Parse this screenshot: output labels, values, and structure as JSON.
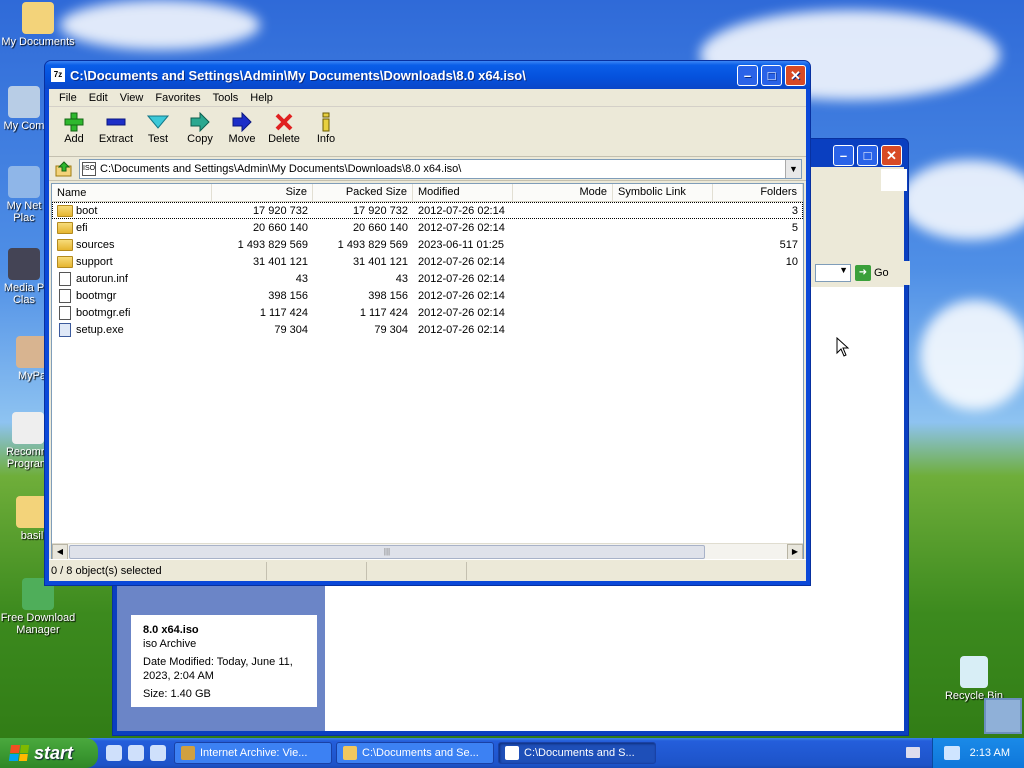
{
  "desktop": {
    "icons": [
      {
        "label": "My Documents"
      },
      {
        "label": "My Com"
      },
      {
        "label": "My Net Plac"
      },
      {
        "label": "Media P Clas"
      },
      {
        "label": "MyPa"
      },
      {
        "label": "Recomm Program"
      },
      {
        "label": "basil"
      },
      {
        "label": "Free Download Manager"
      },
      {
        "label": "Recycle Bin"
      }
    ]
  },
  "background_window": {
    "go_label": "Go",
    "details": {
      "name": "8.0 x64.iso",
      "type": "iso Archive",
      "date_modified": "Date Modified: Today, June 11, 2023, 2:04 AM",
      "size": "Size: 1.40 GB"
    }
  },
  "window": {
    "title": "C:\\Documents and Settings\\Admin\\My Documents\\Downloads\\8.0 x64.iso\\",
    "app_icon_text": "7z",
    "menu": [
      "File",
      "Edit",
      "View",
      "Favorites",
      "Tools",
      "Help"
    ],
    "toolbar": [
      {
        "label": "Add",
        "icon": "plus-icon"
      },
      {
        "label": "Extract",
        "icon": "minus-icon"
      },
      {
        "label": "Test",
        "icon": "check-icon"
      },
      {
        "label": "Copy",
        "icon": "copy-arrow-icon"
      },
      {
        "label": "Move",
        "icon": "move-arrow-icon"
      },
      {
        "label": "Delete",
        "icon": "delete-x-icon"
      },
      {
        "label": "Info",
        "icon": "info-icon"
      }
    ],
    "address": "C:\\Documents and Settings\\Admin\\My Documents\\Downloads\\8.0 x64.iso\\",
    "address_icon_text": "ISO",
    "columns": [
      "Name",
      "Size",
      "Packed Size",
      "Modified",
      "Mode",
      "Symbolic Link",
      "Folders"
    ],
    "rows": [
      {
        "name": "boot",
        "size": "17 920 732",
        "packed": "17 920 732",
        "modified": "2012-07-26 02:14",
        "mode": "",
        "symlink": "",
        "folders": "3",
        "kind": "folder"
      },
      {
        "name": "efi",
        "size": "20 660 140",
        "packed": "20 660 140",
        "modified": "2012-07-26 02:14",
        "mode": "",
        "symlink": "",
        "folders": "5",
        "kind": "folder"
      },
      {
        "name": "sources",
        "size": "1 493 829 569",
        "packed": "1 493 829 569",
        "modified": "2023-06-11 01:25",
        "mode": "",
        "symlink": "",
        "folders": "517",
        "kind": "folder"
      },
      {
        "name": "support",
        "size": "31 401 121",
        "packed": "31 401 121",
        "modified": "2012-07-26 02:14",
        "mode": "",
        "symlink": "",
        "folders": "10",
        "kind": "folder"
      },
      {
        "name": "autorun.inf",
        "size": "43",
        "packed": "43",
        "modified": "2012-07-26 02:14",
        "mode": "",
        "symlink": "",
        "folders": "",
        "kind": "file"
      },
      {
        "name": "bootmgr",
        "size": "398 156",
        "packed": "398 156",
        "modified": "2012-07-26 02:14",
        "mode": "",
        "symlink": "",
        "folders": "",
        "kind": "file"
      },
      {
        "name": "bootmgr.efi",
        "size": "1 117 424",
        "packed": "1 117 424",
        "modified": "2012-07-26 02:14",
        "mode": "",
        "symlink": "",
        "folders": "",
        "kind": "file"
      },
      {
        "name": "setup.exe",
        "size": "79 304",
        "packed": "79 304",
        "modified": "2012-07-26 02:14",
        "mode": "",
        "symlink": "",
        "folders": "",
        "kind": "exe"
      }
    ],
    "status": "0 / 8 object(s) selected"
  },
  "taskbar": {
    "start_label": "start",
    "tasks": [
      {
        "label": "Internet Archive: Vie...",
        "active": false
      },
      {
        "label": "C:\\Documents and Se...",
        "active": false
      },
      {
        "label": "C:\\Documents and S...",
        "active": true
      }
    ],
    "clock": "2:13 AM"
  },
  "colors": {
    "titlebar": "#0551dc",
    "start_green": "#3c9a32",
    "delete_red": "#e02020",
    "add_green": "#2eb82e"
  }
}
